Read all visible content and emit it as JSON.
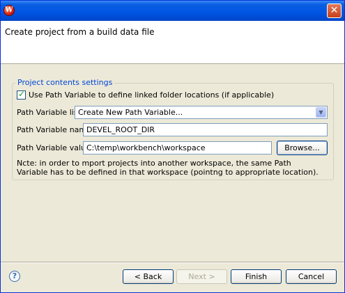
{
  "window": {
    "close_glyph": "✕",
    "app_icon_letter": "W"
  },
  "banner": {
    "title": "Create project from a build data file"
  },
  "group": {
    "legend": "Project contents settings",
    "use_path_variable": {
      "label": "Use Path Variable to define linked folder locations (if applicable)",
      "checked": true
    },
    "path_variable_list": {
      "label": "Path Variable list",
      "value": "Create New Path Variable..."
    },
    "path_variable_name": {
      "label": "Path Variable name",
      "value": "DEVEL_ROOT_DIR"
    },
    "path_variable_value": {
      "label": "Path Variable value",
      "value": "C:\\temp\\workbench\\workspace"
    },
    "browse_label": "Browse...",
    "note": "Ncte: in order to mport projects into another workspace, the same Path Variable has to be defined in that workspace (pointng to appropriate location)."
  },
  "buttons": {
    "back": "< Back",
    "next": "Next >",
    "finish": "Finish",
    "cancel": "Cancel"
  },
  "icons": {
    "help": "help-icon",
    "close": "close-icon",
    "app": "app-icon",
    "combo": "chevron-down-icon"
  }
}
